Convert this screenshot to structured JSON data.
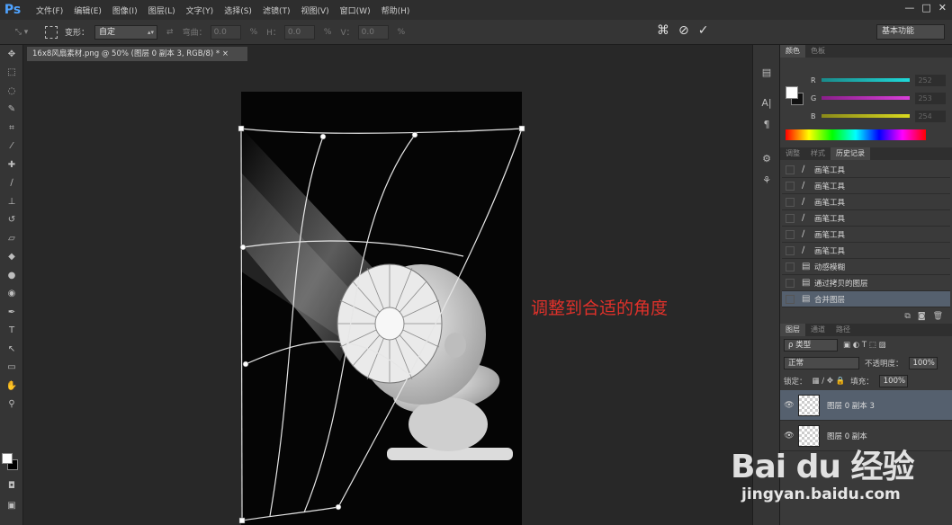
{
  "app": {
    "logo": "Ps"
  },
  "menu": [
    "文件(F)",
    "编辑(E)",
    "图像(I)",
    "图层(L)",
    "文字(Y)",
    "选择(S)",
    "滤镜(T)",
    "视图(V)",
    "窗口(W)",
    "帮助(H)"
  ],
  "window_controls": [
    "—",
    "□",
    "✕"
  ],
  "options": {
    "tool_label": "变形：",
    "warp_value": "自定",
    "bend_label": "弯曲：",
    "bend_value": "0.0",
    "h_label": "H：",
    "h_value": "0.0",
    "v_label": "V：",
    "v_value": "0.0",
    "pct": "%",
    "workspace": "基本功能"
  },
  "document_tab": "16x8风扇素材.png @ 50% (图层 0 副本 3, RGB/8) * ×",
  "annotation": "调整到合适的角度",
  "color_panel": {
    "tabs": [
      "颜色",
      "色板"
    ],
    "rows": [
      {
        "label": "R",
        "value": "252",
        "color": "#1fd9d9"
      },
      {
        "label": "G",
        "value": "253",
        "color": "#d93fd9"
      },
      {
        "label": "B",
        "value": "254",
        "color": "#d9d91f"
      }
    ]
  },
  "history_panel": {
    "tabs": [
      "调整",
      "样式",
      "历史记录"
    ],
    "items": [
      {
        "icon": "brush-icon",
        "label": "画笔工具"
      },
      {
        "icon": "brush-icon",
        "label": "画笔工具"
      },
      {
        "icon": "brush-icon",
        "label": "画笔工具"
      },
      {
        "icon": "brush-icon",
        "label": "画笔工具"
      },
      {
        "icon": "brush-icon",
        "label": "画笔工具"
      },
      {
        "icon": "brush-icon",
        "label": "画笔工具"
      },
      {
        "icon": "doc-icon",
        "label": "动感模糊"
      },
      {
        "icon": "doc-icon",
        "label": "通过拷贝的图层"
      },
      {
        "icon": "doc-icon",
        "label": "合并图层",
        "selected": true
      }
    ]
  },
  "layers_panel": {
    "tabs": [
      "图层",
      "通道",
      "路径"
    ],
    "kind": "ρ 类型",
    "blend_mode": "正常",
    "opacity_label": "不透明度：",
    "opacity_value": "100%",
    "lock_label": "锁定：",
    "fill_label": "填充：",
    "fill_value": "100%",
    "layers": [
      {
        "name": "图层 0 副本 3",
        "selected": true
      },
      {
        "name": "图层 0 副本",
        "selected": false
      }
    ]
  },
  "watermark": {
    "logo": "Bai du 经验",
    "url": "jingyan.baidu.com"
  }
}
